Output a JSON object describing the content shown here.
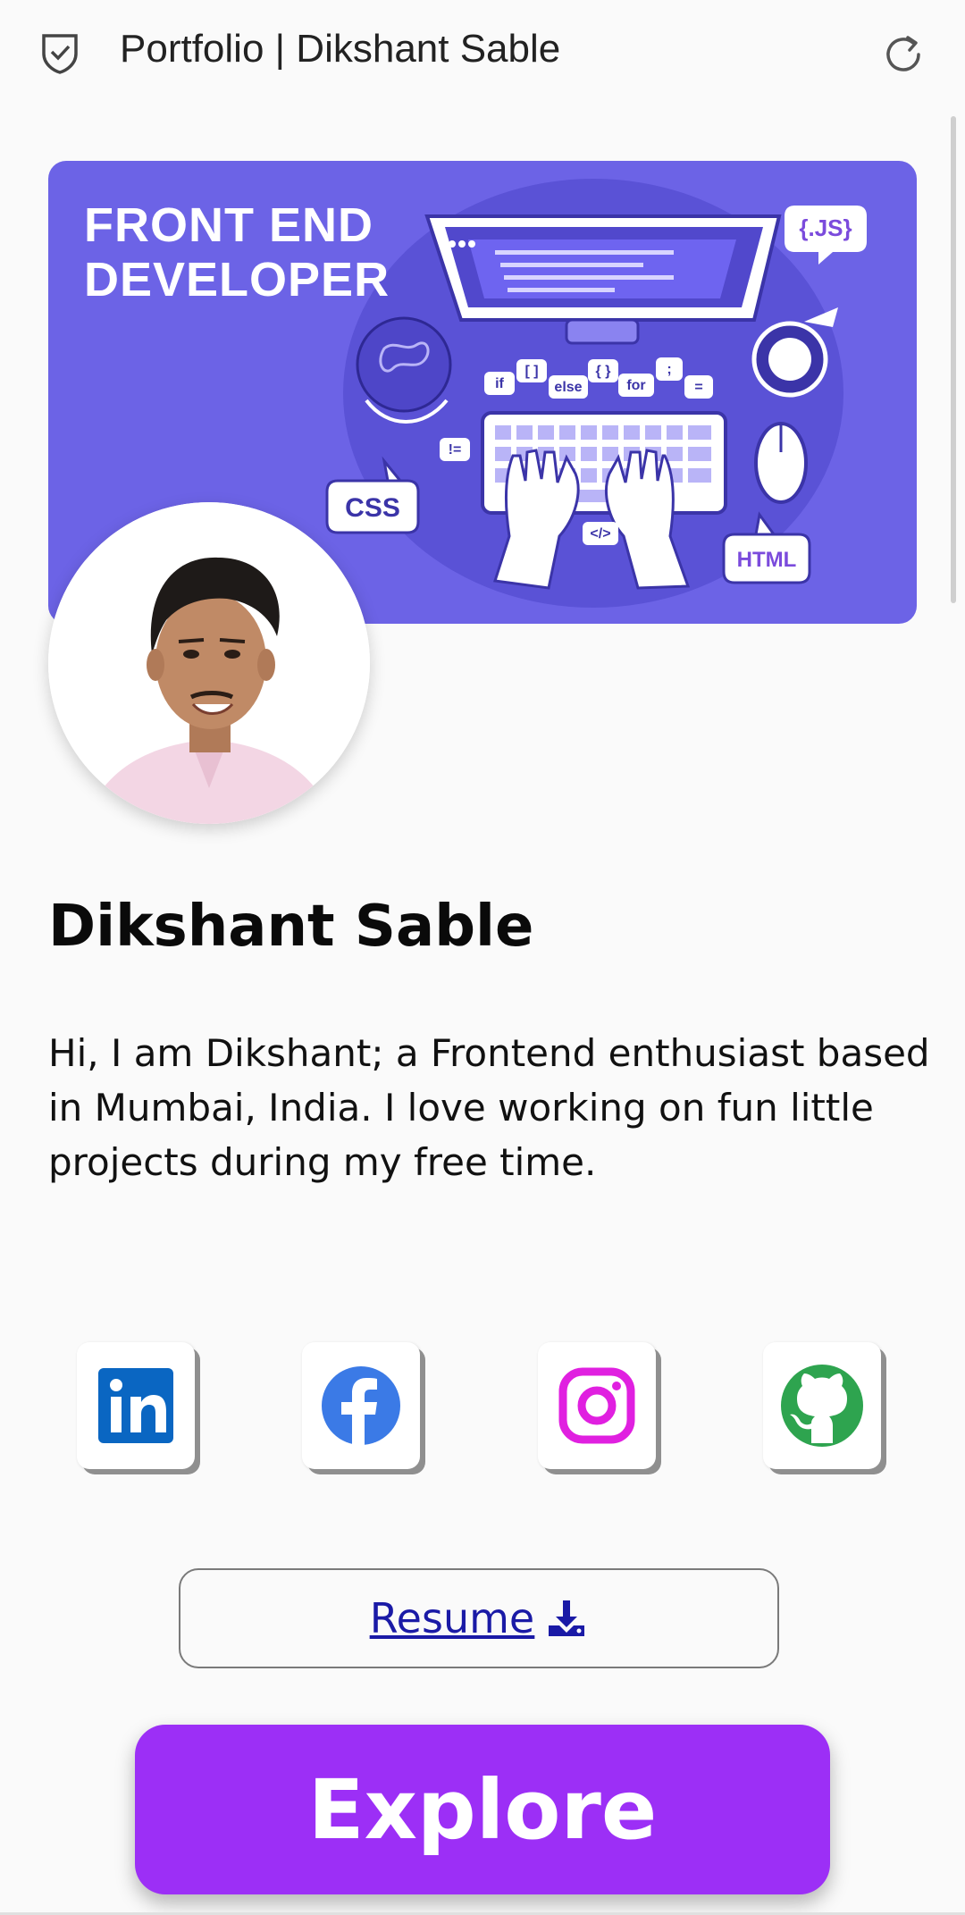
{
  "topbar": {
    "title": "Portfolio | Dikshant Sable",
    "shield_icon": "shield-check-icon",
    "reload_icon": "reload-icon"
  },
  "banner": {
    "headline": "FRONT END DEVELOPER",
    "labels": {
      "js": "{.JS}",
      "css": "CSS",
      "html": "HTML",
      "if": "if",
      "brackets": "[ ]",
      "else": "else",
      "braces": "{ }",
      "for": "for",
      "semicolon": ";",
      "equals": "=",
      "not_equal": "!=",
      "tag": "</>"
    },
    "colors": {
      "background": "#6c63e6",
      "accent": "#ffffff",
      "purple_text": "#7b4bdc"
    }
  },
  "profile": {
    "name": "Dikshant Sable",
    "bio": "Hi, I am Dikshant; a Frontend enthusiast based in Mumbai, India. I love working on fun little projects during my free time."
  },
  "social": [
    {
      "name": "linkedin",
      "icon": "linkedin-icon",
      "color": "#0a66c2"
    },
    {
      "name": "facebook",
      "icon": "facebook-icon",
      "color": "#3b7ae6"
    },
    {
      "name": "instagram",
      "icon": "instagram-icon",
      "color": "#e020e0"
    },
    {
      "name": "github",
      "icon": "github-icon",
      "color": "#2ea44f"
    }
  ],
  "resume": {
    "label": "Resume",
    "icon": "download-icon",
    "color": "#1a1aa6"
  },
  "explore": {
    "label": "Explore",
    "color": "#9c2ff6"
  }
}
